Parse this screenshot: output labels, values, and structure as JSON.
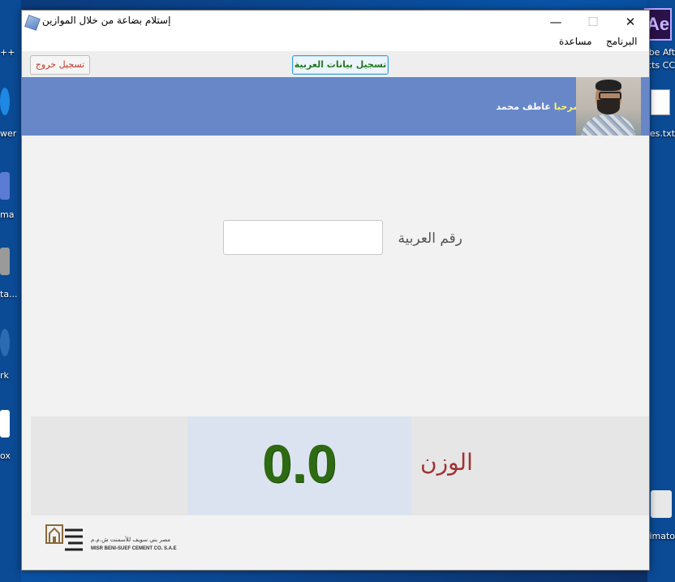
{
  "desktop": {
    "left_icons": [
      "++",
      "wer",
      "ma",
      "ta...",
      "rk",
      "ox"
    ],
    "right_icons": [
      "be Aft",
      "cts CC",
      "ales.txt",
      "cimato"
    ],
    "ae_tile": "Ae"
  },
  "window": {
    "title": "إستلام بضاعة من خلال الموازين",
    "controls": {
      "minimize": "—",
      "maximize": "☐",
      "close": "✕"
    }
  },
  "menu": {
    "program": "البرنامج",
    "help": "مساعدة"
  },
  "toolbar": {
    "logout": "تسجيل خروج",
    "register_vehicle": "تسجيل بيانات العربية"
  },
  "banner": {
    "welcome": "مرحبا",
    "user_name": "عاطف محمد"
  },
  "form": {
    "truck_number_label": "رقم العربية",
    "truck_number_value": ""
  },
  "weight": {
    "label": "الوزن",
    "value": "0.0"
  },
  "footer": {
    "company_ar": "مصر بني سويف للأسمنت ش.م.م",
    "company_en": "MISR BENI-SUEF CEMENT CO. S.A.E",
    "logo_text": "مصر بني سويف"
  },
  "colors": {
    "banner": "#6787c9",
    "weight_value": "#2e6a12",
    "weight_label": "#a23131",
    "register_text": "#1f7a1f",
    "logout_text": "#c0392b"
  }
}
